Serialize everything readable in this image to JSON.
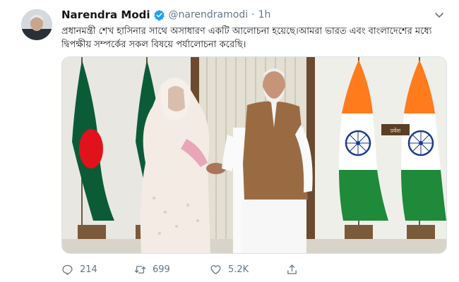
{
  "tweet": {
    "display_name": "Narendra Modi",
    "handle": "@narendramodi",
    "separator": "·",
    "time": "1h",
    "text": "প্রধানমন্ত্রী শেখ হাসিনার সাথে অসাধারণ একটি আলোচনা হয়েছে।আমরা ভারত এবং বাংলাদেশের মধ্যে দ্বিপক্ষীয় সম্পর্কের সকল বিষয়ে পর্যালোচনা করেছি।",
    "photo_sign_text": "प्रवेश"
  },
  "actions": {
    "replies": "214",
    "retweets": "699",
    "likes": "5.2K"
  },
  "icons": {
    "avatar": "avatar",
    "verified": "verified-badge-icon",
    "menu": "chevron-down-icon",
    "reply": "reply-icon",
    "retweet": "retweet-icon",
    "like": "heart-icon",
    "share": "share-icon"
  },
  "colors": {
    "verified": "#1da1f2",
    "secondary_text": "#657786",
    "bangladesh_green": "#0b5c36",
    "bangladesh_red": "#e0121b",
    "india_saffron": "#ff7b1c",
    "india_green": "#1f8a3a",
    "chakra_blue": "#1a3a8c"
  }
}
